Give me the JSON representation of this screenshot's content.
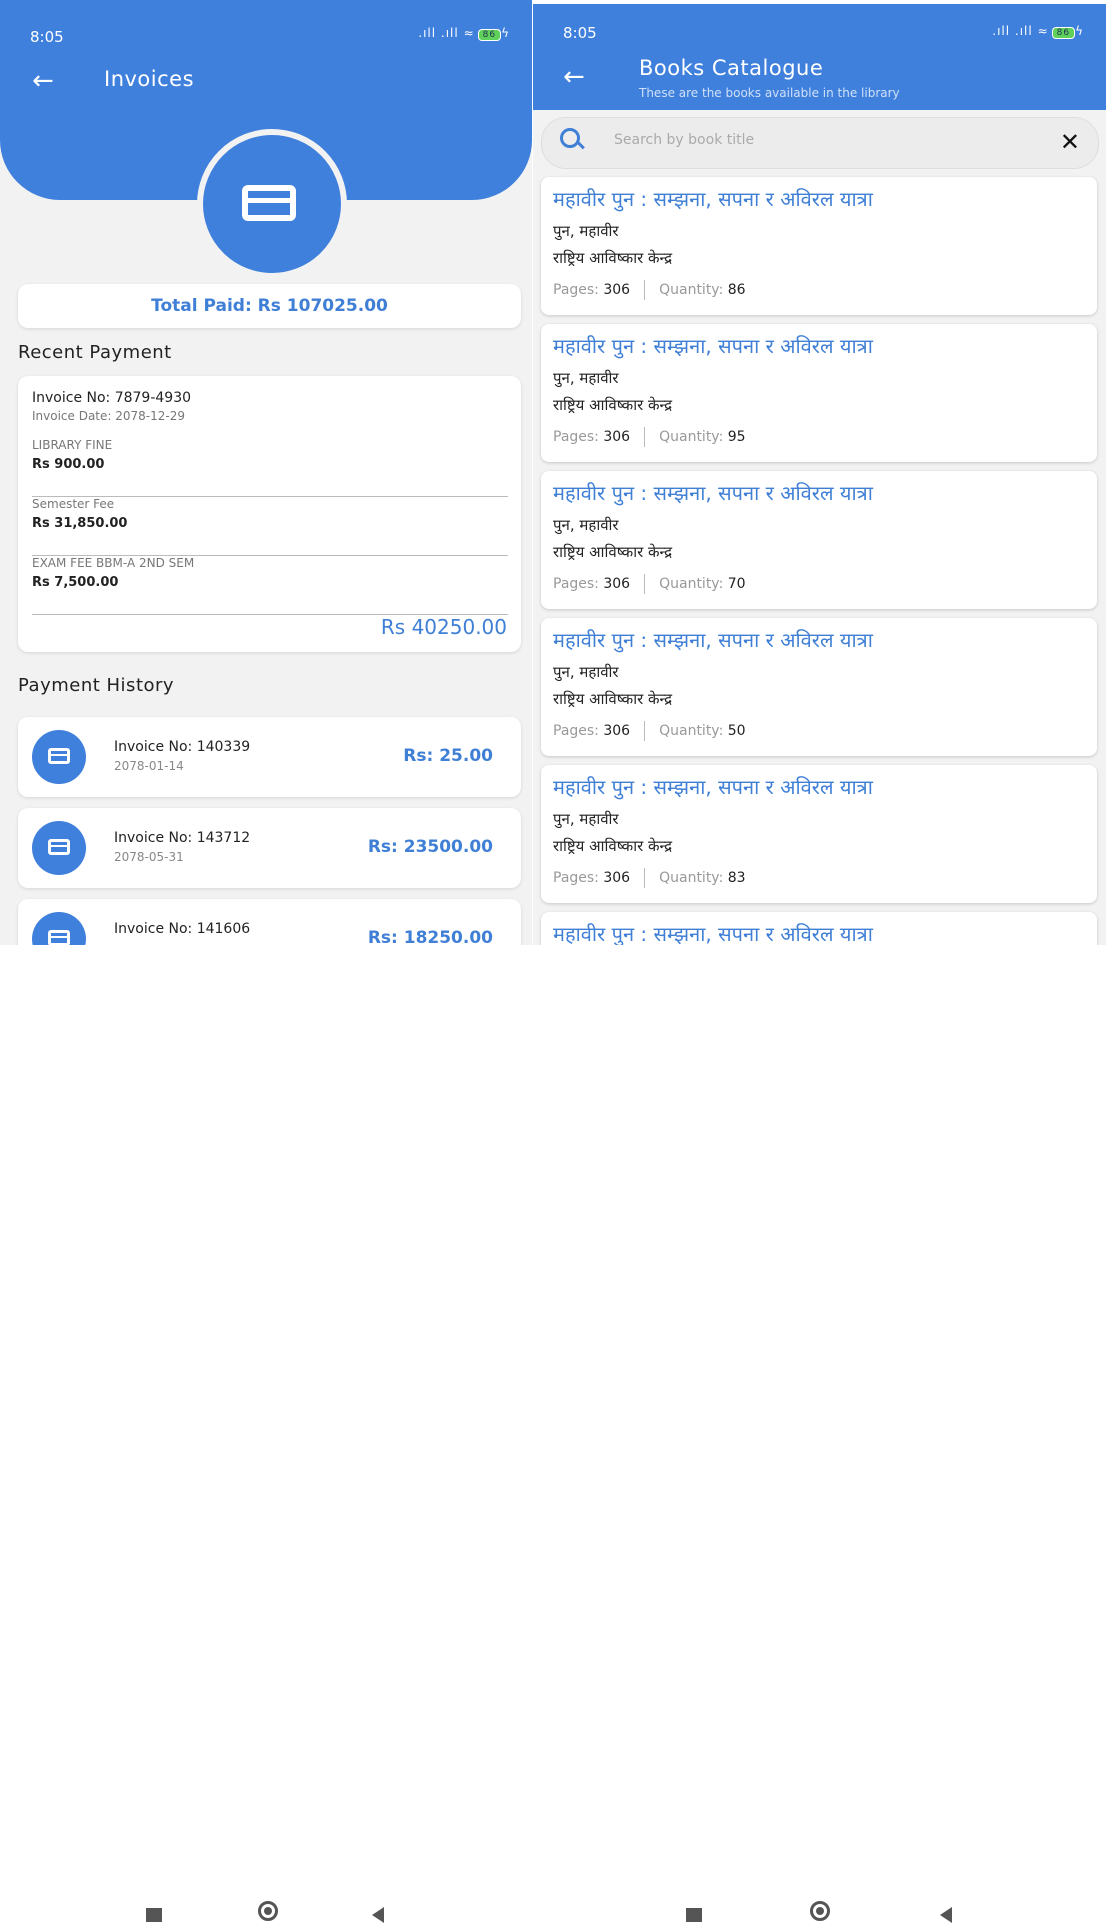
{
  "left": {
    "status": {
      "time": "8:05",
      "signal": ".ıll .ıll",
      "wifi": "≈",
      "battery": "86",
      "charge": "ϟ"
    },
    "title": "Invoices",
    "total_paid": "Total Paid: Rs 107025.00",
    "recent_title": "Recent Payment",
    "recent": {
      "invoice_no": "Invoice No: 7879-4930",
      "invoice_date": "Invoice Date: 2078-12-29",
      "items": [
        {
          "label": "LIBRARY FINE",
          "amount": "Rs 900.00"
        },
        {
          "label": "Semester Fee",
          "amount": "Rs 31,850.00"
        },
        {
          "label": "EXAM FEE BBM-A 2ND SEM",
          "amount": "Rs 7,500.00"
        }
      ],
      "total": "Rs 40250.00"
    },
    "history_title": "Payment History",
    "history": [
      {
        "no": "Invoice No: 140339",
        "date": "2078-01-14",
        "amount": "Rs: 25.00"
      },
      {
        "no": "Invoice No: 143712",
        "date": "2078-05-31",
        "amount": "Rs: 23500.00"
      },
      {
        "no": "Invoice No: 141606",
        "date": "",
        "amount": "Rs: 18250.00"
      }
    ]
  },
  "right": {
    "status": {
      "time": "8:05",
      "signal": ".ıll .ıll",
      "wifi": "≈",
      "battery": "86",
      "charge": "ϟ"
    },
    "title": "Books Catalogue",
    "subtitle": "These are the books available in the library",
    "search_placeholder": "Search by book title",
    "clear_icon": "✕",
    "books": [
      {
        "title": "महावीर पुन : सम्झना, सपना र अविरल यात्रा",
        "author": "पुन, महावीर",
        "publisher": "राष्ट्रिय आविष्कार केन्द्र",
        "pages_label": "Pages:",
        "pages": "306",
        "qty_label": "Quantity:",
        "qty": "86"
      },
      {
        "title": "महावीर पुन : सम्झना, सपना र अविरल यात्रा",
        "author": "पुन, महावीर",
        "publisher": "राष्ट्रिय आविष्कार केन्द्र",
        "pages_label": "Pages:",
        "pages": "306",
        "qty_label": "Quantity:",
        "qty": "95"
      },
      {
        "title": "महावीर पुन : सम्झना, सपना र अविरल यात्रा",
        "author": "पुन, महावीर",
        "publisher": "राष्ट्रिय आविष्कार केन्द्र",
        "pages_label": "Pages:",
        "pages": "306",
        "qty_label": "Quantity:",
        "qty": "70"
      },
      {
        "title": "महावीर पुन : सम्झना, सपना र अविरल यात्रा",
        "author": "पुन, महावीर",
        "publisher": "राष्ट्रिय आविष्कार केन्द्र",
        "pages_label": "Pages:",
        "pages": "306",
        "qty_label": "Quantity:",
        "qty": "50"
      },
      {
        "title": "महावीर पुन : सम्झना, सपना र अविरल यात्रा",
        "author": "पुन, महावीर",
        "publisher": "राष्ट्रिय आविष्कार केन्द्र",
        "pages_label": "Pages:",
        "pages": "306",
        "qty_label": "Quantity:",
        "qty": "83"
      },
      {
        "title": "महावीर पुन : सम्झना, सपना र अविरल यात्रा",
        "author": "",
        "publisher": "",
        "pages_label": "",
        "pages": "",
        "qty_label": "",
        "qty": ""
      }
    ]
  },
  "icons": {
    "back": "arrow-left-icon",
    "card": "credit-card-icon",
    "search": "search-icon",
    "clear": "close-icon"
  },
  "colors": {
    "accent": "#3f80dc",
    "amount_blue": "#3f7fd6",
    "background": "#f2f2f2"
  }
}
